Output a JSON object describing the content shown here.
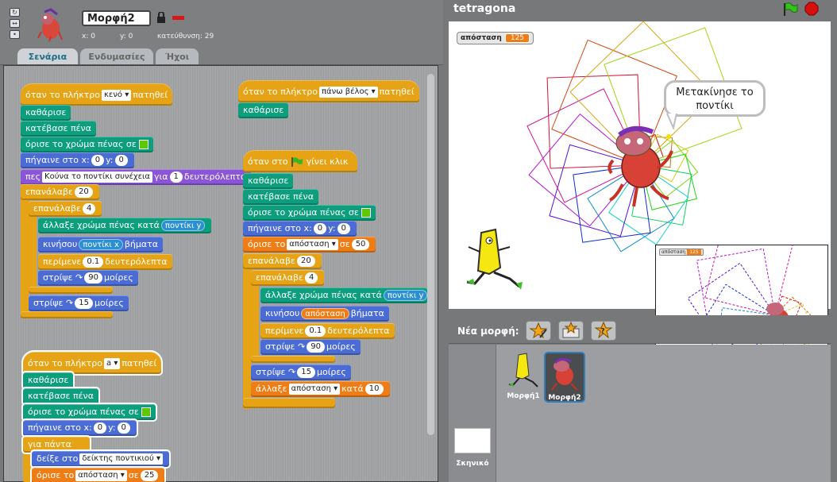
{
  "sprite": {
    "name": "Μορφή2",
    "x_label": "x:",
    "x": "0",
    "y_label": "y:",
    "y": "0",
    "dir_label": "κατεύθυνση:",
    "dir": "29"
  },
  "tabs": [
    {
      "label": "Σενάρια"
    },
    {
      "label": "Ενδυμασίες"
    },
    {
      "label": "Ήχοι"
    }
  ],
  "script1": {
    "hat": {
      "t1": "όταν το πλήκτρο",
      "key": "κενό",
      "t2": "πατηθεί"
    },
    "clear": "καθάρισε",
    "pen_down": "κατέβασε πένα",
    "set_color": "όρισε το χρώμα πένας σε",
    "goto": {
      "t1": "πήγαινε στο x:",
      "x": "0",
      "t2": "y:",
      "y": "0"
    },
    "say": {
      "t1": "πες",
      "msg": "Κούνα το ποντίκι συνέχεια",
      "t2": "για",
      "n": "1",
      "t3": "δευτερόλεπτα"
    },
    "repeat_outer": {
      "t": "επανάλαβε",
      "n": "20"
    },
    "repeat_inner": {
      "t": "επανάλαβε",
      "n": "4"
    },
    "change_color": {
      "t": "άλλαξε χρώμα πένας κατά",
      "rep": "ποντίκι y"
    },
    "move": {
      "t1": "κινήσου",
      "rep": "ποντίκι x",
      "t2": "βήματα"
    },
    "wait": {
      "t1": "περίμενε",
      "n": "0.1",
      "t2": "δευτερόλεπτα"
    },
    "turn1": {
      "t1": "στρίψε",
      "n": "90",
      "t2": "μοίρες"
    },
    "turn2": {
      "t1": "στρίψε",
      "n": "15",
      "t2": "μοίρες"
    }
  },
  "script2": {
    "hat": {
      "t1": "όταν το πλήκτρο",
      "key": "πάνω βέλος",
      "t2": "πατηθεί"
    },
    "clear": "καθάρισε"
  },
  "script3": {
    "hat": {
      "t1": "όταν στο",
      "t2": "γίνει κλικ"
    },
    "clear": "καθάρισε",
    "pen_down": "κατέβασε πένα",
    "set_color": "όρισε το χρώμα πένας σε",
    "goto": {
      "t1": "πήγαινε στο x:",
      "x": "0",
      "t2": "y:",
      "y": "0"
    },
    "setvar": {
      "t1": "όρισε το",
      "var": "απόσταση",
      "t2": "σε",
      "n": "50"
    },
    "repeat_outer": {
      "t": "επανάλαβε",
      "n": "20"
    },
    "repeat_inner": {
      "t": "επανάλαβε",
      "n": "4"
    },
    "change_color": {
      "t": "άλλαξε χρώμα πένας κατά",
      "rep": "ποντίκι y"
    },
    "move": {
      "t1": "κινήσου",
      "rep": "απόσταση",
      "t2": "βήματα"
    },
    "wait": {
      "t1": "περίμενε",
      "n": "0.1",
      "t2": "δευτερόλεπτα"
    },
    "turn1": {
      "t1": "στρίψε",
      "n": "90",
      "t2": "μοίρες"
    },
    "turn2": {
      "t1": "στρίψε",
      "n": "15",
      "t2": "μοίρες"
    },
    "changevar": {
      "t1": "άλλαξε",
      "var": "απόσταση",
      "t2": "κατά",
      "n": "10"
    }
  },
  "script4": {
    "hat": {
      "t1": "όταν το πλήκτρο",
      "key": "a",
      "t2": "πατηθεί"
    },
    "clear": "καθάρισε",
    "pen_down": "κατέβασε πένα",
    "set_color": "όρισε το χρώμα πένας σε",
    "goto": {
      "t1": "πήγαινε στο x:",
      "x": "0",
      "t2": "y:",
      "y": "0"
    },
    "forever": "για πάντα",
    "point": {
      "t1": "δείξε στο",
      "target": "δείκτης ποντικιού"
    },
    "setvar": {
      "t1": "όρισε το",
      "var": "απόσταση",
      "t2": "σε",
      "n": "25"
    }
  },
  "stage": {
    "title": "tetragona",
    "var_name": "απόσταση",
    "var_value": "125",
    "speech": "Μετακίνησε το ποντίκι",
    "mini_var": "απόσταση",
    "mini_val": "125"
  },
  "sprites_panel": {
    "new_sprite": "Νέα μορφή:",
    "sprites": [
      {
        "label": "Μορφή1"
      },
      {
        "label": "Μορφή2"
      }
    ],
    "stage_label": "Σκηνικό"
  },
  "colors": {
    "control": "#e5a315",
    "pen": "#0d9e7d",
    "motion": "#4a6cd4",
    "looks": "#8a55d7",
    "variables": "#ee7d16",
    "sensing": "#2c8fd0"
  }
}
